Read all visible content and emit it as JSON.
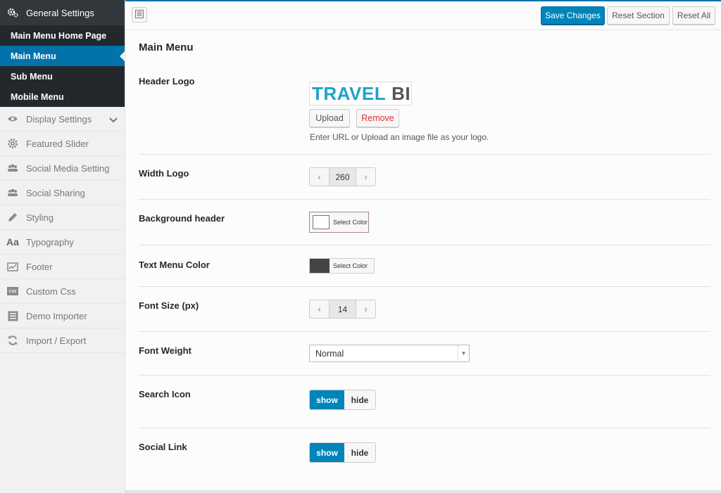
{
  "sidebar": {
    "group_title": "General Settings",
    "sub_items": [
      {
        "label": "Main Menu Home Page"
      },
      {
        "label": "Main Menu"
      },
      {
        "label": "Sub Menu"
      },
      {
        "label": "Mobile Menu"
      }
    ],
    "active_sub_item": "Main Menu",
    "items": [
      {
        "label": "Display Settings",
        "icon": "eye-icon"
      },
      {
        "label": "Featured Slider",
        "icon": "gear-icon"
      },
      {
        "label": "Social Media Setting",
        "icon": "users-icon"
      },
      {
        "label": "Social Sharing",
        "icon": "users-icon"
      },
      {
        "label": "Styling",
        "icon": "pencil-icon"
      },
      {
        "label": "Typography",
        "icon": "typography-icon"
      },
      {
        "label": "Footer",
        "icon": "chart-icon"
      },
      {
        "label": "Custom Css",
        "icon": "css-icon"
      },
      {
        "label": "Demo Importer",
        "icon": "import-icon"
      },
      {
        "label": "Import / Export",
        "icon": "refresh-icon"
      }
    ]
  },
  "toolbar": {
    "save_label": "Save Changes",
    "reset_section_label": "Reset Section",
    "reset_all_label": "Reset All"
  },
  "main": {
    "section_title": "Main Menu",
    "header_logo": {
      "label": "Header Logo",
      "logo_text_1": "TRAVEL",
      "logo_text_2": "BI",
      "upload_label": "Upload",
      "remove_label": "Remove",
      "description": "Enter URL or Upload an image file as your logo."
    },
    "width_logo": {
      "label": "Width Logo",
      "value": "260"
    },
    "background_header": {
      "label": "Background header",
      "button_label": "Select Color",
      "color": "#ffffff"
    },
    "text_menu_color": {
      "label": "Text Menu Color",
      "button_label": "Select Color",
      "color": "#444444"
    },
    "font_size": {
      "label": "Font Size (px)",
      "value": "14"
    },
    "font_weight": {
      "label": "Font Weight",
      "selected": "Normal"
    },
    "search_icon": {
      "label": "Search Icon",
      "on_label": "show",
      "off_label": "hide",
      "state": "show"
    },
    "social_link": {
      "label": "Social Link",
      "on_label": "show",
      "off_label": "hide",
      "state": "show"
    }
  },
  "colors": {
    "accent": "#0085ba",
    "sidebar_dark": "#23282d",
    "active": "#0073aa"
  }
}
